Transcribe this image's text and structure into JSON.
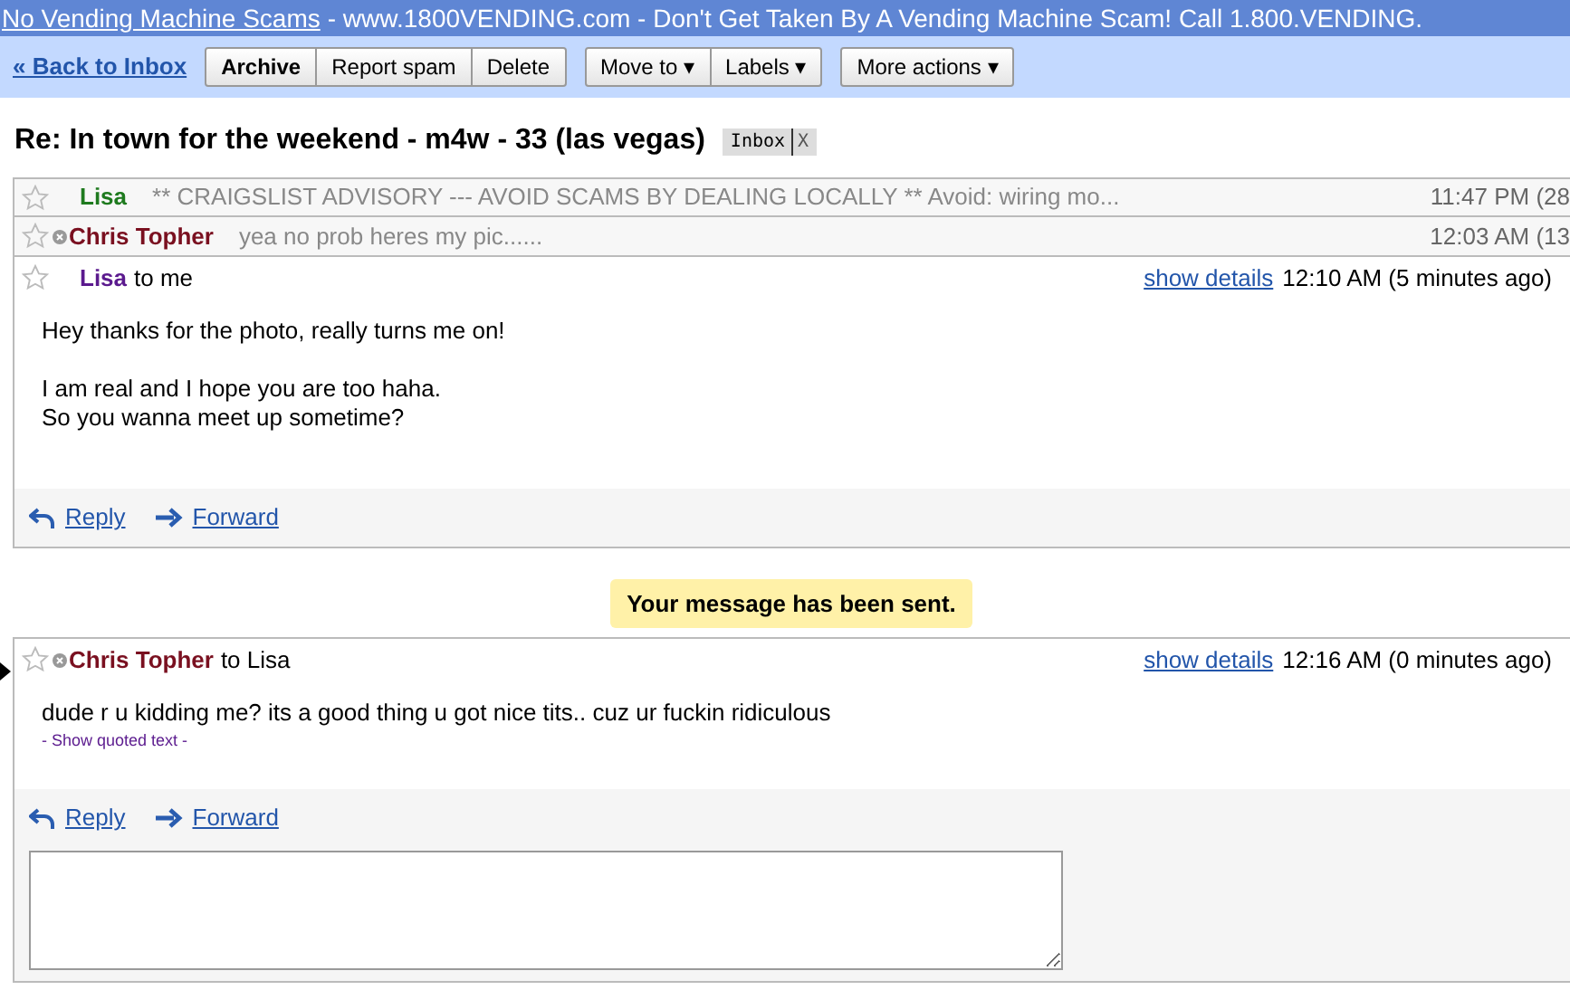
{
  "ad_bar": {
    "link": "No Vending Machine Scams",
    "text": "- www.1800VENDING.com - Don't Get Taken By A Vending Machine Scam! Call 1.800.VENDING."
  },
  "toolbar": {
    "back_link": "« Back to Inbox",
    "button_groups": [
      [
        "Archive",
        "Report spam",
        "Delete"
      ],
      [
        "Move to ▾",
        "Labels ▾"
      ],
      [
        "More actions ▾"
      ]
    ]
  },
  "subject": {
    "title": "Re: In town for the weekend - m4w - 33 (las vegas)",
    "label": "Inbox",
    "remove": "X"
  },
  "messages": [
    {
      "kind": "collapsed",
      "starred": false,
      "presence": false,
      "sender": "Lisa",
      "color": "#1e7a1e",
      "snippet": "** CRAIGSLIST ADVISORY --- AVOID SCAMS BY DEALING LOCALLY ** Avoid: wiring mo...",
      "time": "11:47 PM (28"
    },
    {
      "kind": "collapsed",
      "starred": false,
      "presence": true,
      "sender": "Chris Topher",
      "color": "#7a1020",
      "snippet": "yea no prob heres my pic......",
      "time": "12:03 AM (13"
    },
    {
      "kind": "expanded",
      "starred": false,
      "presence": false,
      "current": false,
      "sender": "Lisa",
      "color": "#5b1a8e",
      "recipient": "to me",
      "details": "show details",
      "time": "12:10 AM (5 minutes ago)",
      "body": [
        [
          "Hey thanks for the photo, really turns me on!"
        ],
        [
          "I am real and I hope you are too haha.",
          "So you wanna meet up sometime?"
        ]
      ],
      "reply": "Reply",
      "forward": "Forward",
      "compose": false
    },
    {
      "kind": "notice",
      "text": "Your message has been sent."
    },
    {
      "kind": "expanded",
      "starred": false,
      "presence": true,
      "current": true,
      "sender": "Chris Topher",
      "color": "#7a1020",
      "recipient": "to Lisa",
      "details": "show details",
      "time": "12:16 AM (0 minutes ago)",
      "body": [
        [
          "dude r u kidding me? its a good thing u got nice tits.. cuz ur fuckin ridiculous"
        ]
      ],
      "quoted": "- Show quoted text -",
      "reply": "Reply",
      "forward": "Forward",
      "compose": true
    }
  ]
}
